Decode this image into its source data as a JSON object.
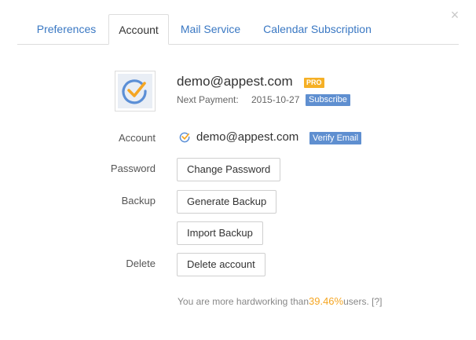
{
  "tabs": [
    {
      "label": "Preferences",
      "active": false
    },
    {
      "label": "Account",
      "active": true
    },
    {
      "label": "Mail Service",
      "active": false
    },
    {
      "label": "Calendar Subscription",
      "active": false
    }
  ],
  "close_icon": "×",
  "profile": {
    "avatar_icon": "checkmark-icon",
    "email": "demo@appest.com",
    "pro_badge": "PRO",
    "next_payment_label": "Next Payment:",
    "next_payment_date": "2015-10-27",
    "subscribe_label": "Subscribe"
  },
  "rows": {
    "account_label": "Account",
    "account_email": "demo@appest.com",
    "verify_label": "Verify Email",
    "password_label": "Password",
    "change_password_button": "Change Password",
    "backup_label": "Backup",
    "generate_backup_button": "Generate Backup",
    "import_backup_button": "Import Backup",
    "delete_label": "Delete",
    "delete_account_button": "Delete account"
  },
  "stats": {
    "prefix": "You are more hardworking than",
    "percent": "39.46%",
    "suffix": "users.",
    "help": "[?]"
  },
  "colors": {
    "accent_blue": "#3a78c3",
    "badge_blue": "#5f8fd0",
    "pro_orange": "#f5b026",
    "highlight_orange": "#f5a623"
  }
}
